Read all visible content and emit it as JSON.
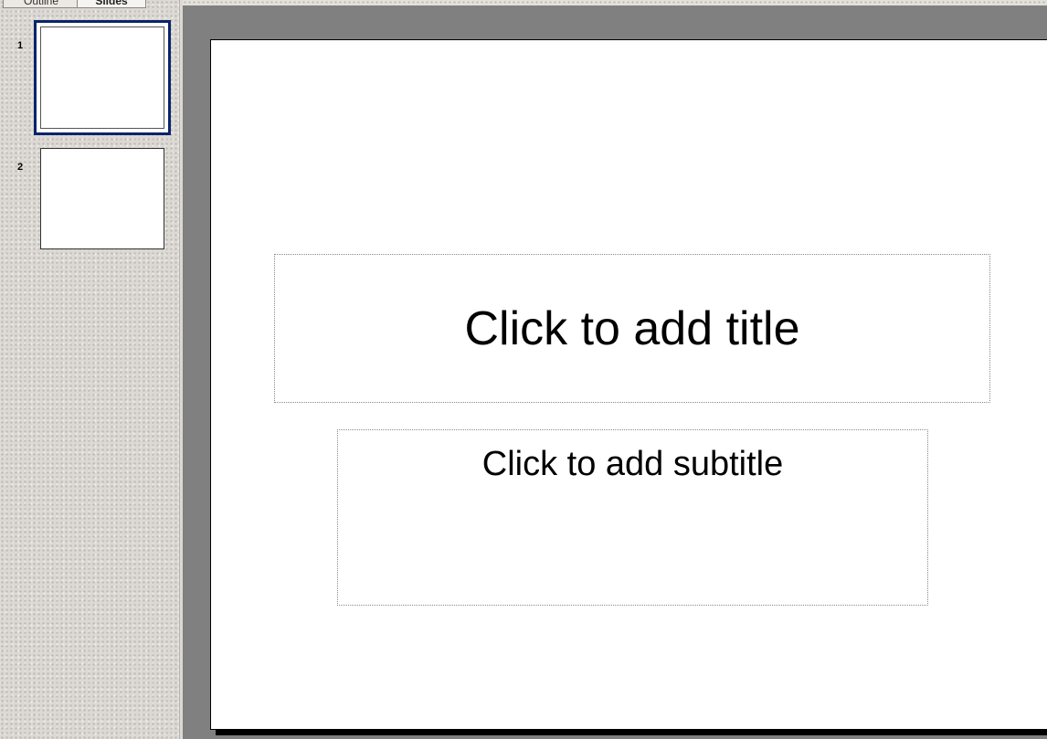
{
  "sidebar": {
    "tabs": [
      {
        "label": "Outline"
      },
      {
        "label": "Slides"
      }
    ],
    "slides": [
      {
        "number": "1"
      },
      {
        "number": "2"
      }
    ]
  },
  "slide": {
    "title_placeholder": "Click to add title",
    "subtitle_placeholder": "Click to add subtitle"
  },
  "colors": {
    "selection_border": "#0a246a",
    "workspace_gray": "#808080",
    "slide_bg": "#ffffff"
  }
}
